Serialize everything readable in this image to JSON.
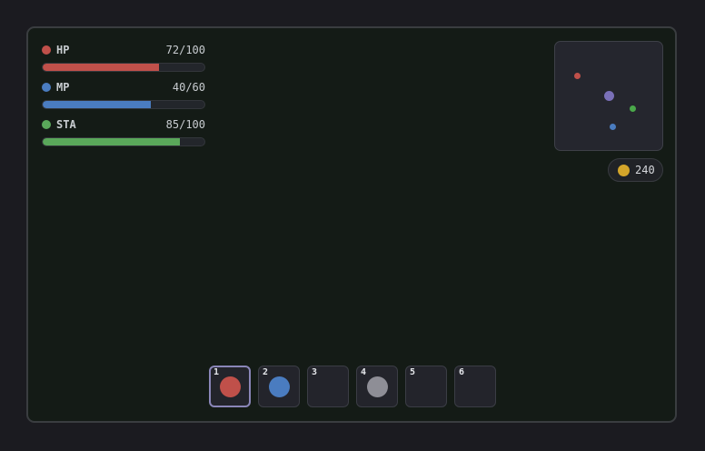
{
  "stats": [
    {
      "name": "HP",
      "value_text": "72/100",
      "current": 72,
      "max": 100,
      "color": "#c0504a"
    },
    {
      "name": "MP",
      "value_text": "40/60",
      "current": 40,
      "max": 60,
      "color": "#4a7cc0"
    },
    {
      "name": "STA",
      "value_text": "85/100",
      "current": 85,
      "max": 100,
      "color": "#5aa85a"
    }
  ],
  "minimap": {
    "markers": [
      {
        "kind": "enemy-marker",
        "color": "#c0504a"
      },
      {
        "kind": "player-marker",
        "color": "#7a70b8"
      },
      {
        "kind": "ally-marker",
        "color": "#4aa84a"
      },
      {
        "kind": "mana-marker",
        "color": "#4a7cc0"
      }
    ]
  },
  "gold": {
    "amount": "240",
    "coin_color": "#d4a52a"
  },
  "hotbar": {
    "selected_index": 0,
    "slots": [
      {
        "number": "1",
        "item": "health-potion",
        "color": "#c0504a"
      },
      {
        "number": "2",
        "item": "mana-potion",
        "color": "#4a7cc0"
      },
      {
        "number": "3",
        "item": null,
        "color": null
      },
      {
        "number": "4",
        "item": "stone",
        "color": "#8e8e96"
      },
      {
        "number": "5",
        "item": null,
        "color": null
      },
      {
        "number": "6",
        "item": null,
        "color": null
      }
    ]
  }
}
